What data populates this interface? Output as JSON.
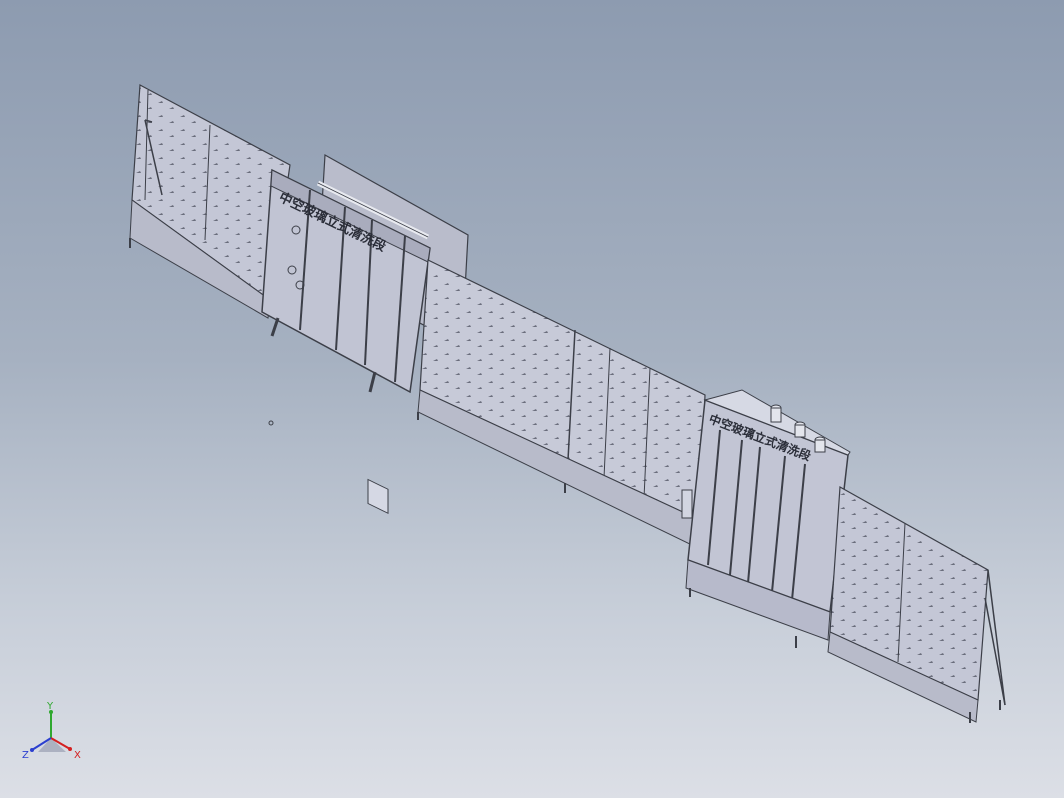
{
  "viewport": {
    "background_top": "#8d9bb0",
    "background_bottom": "#dcdfe6"
  },
  "model": {
    "frame_color": "#3c3f48",
    "panel_color": "#c7cad8",
    "panel_color_dark": "#b4b7c6",
    "machine_color": "#aeb2c4",
    "unit1_label": "中空玻璃立式清洗段",
    "unit2_label": "中空玻璃立式清洗段"
  },
  "triad": {
    "y_label": "Y",
    "x_label": "X",
    "z_label": "Z",
    "y_color": "#2fa82f",
    "x_color": "#d42020",
    "z_color": "#2b3fcf"
  }
}
